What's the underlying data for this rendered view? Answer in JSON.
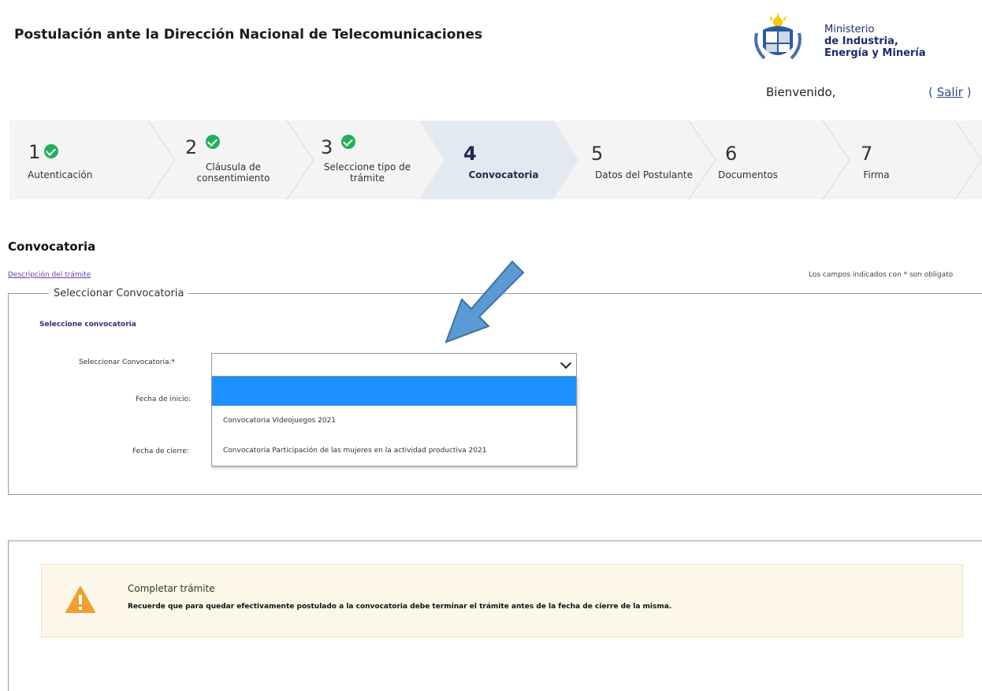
{
  "header": {
    "title": "Postulación ante la Dirección Nacional de Telecomunicaciones",
    "ministry": {
      "line1": "Ministerio",
      "line2": "de Industria,",
      "line3": "Energía y Minería"
    },
    "welcome": "Bienvenido,",
    "logout_open": "( ",
    "logout_label": "Salir",
    "logout_close": " )"
  },
  "steps": [
    {
      "number": "1",
      "label": "Autenticación",
      "completed": true
    },
    {
      "number": "2",
      "label": "Cláusula de consentimiento",
      "completed": true
    },
    {
      "number": "3",
      "label": "Seleccione tipo de trámite",
      "completed": true
    },
    {
      "number": "4",
      "label": "Convocatoria",
      "active": true
    },
    {
      "number": "5",
      "label": "Datos del Postulante"
    },
    {
      "number": "6",
      "label": "Documentos"
    },
    {
      "number": "7",
      "label": "Firma"
    }
  ],
  "section": {
    "title": "Convocatoria",
    "description_link": "Descripción del trámite",
    "required_note": "Los campos indicados con * son obligato"
  },
  "form": {
    "legend": "Seleccionar Convocatoria",
    "subsection": "Seleccione convocatoria",
    "select_label": "Seleccionar Convocatoria:*",
    "start_label": "Fecha de inicio:",
    "end_label": "Fecha de cierre:",
    "options": [
      "",
      "Convocatoria Videojuegos 2021",
      "Convocatoria Participación de las mujeres en la actividad productiva 2021"
    ]
  },
  "alert": {
    "title": "Completar trámite",
    "text": "Recuerde que para quedar efectivamente postulado a la convocatoria debe terminar el trámite antes de la fecha de cierre de la misma."
  },
  "colors": {
    "check_green": "#20b05a",
    "active_step_bg": "#e3e9f0",
    "dropdown_highlight": "#1e90ff",
    "arrow_blue": "#5b9bd5",
    "warning_orange": "#f0a030",
    "alert_bg": "#fcf7e9"
  }
}
